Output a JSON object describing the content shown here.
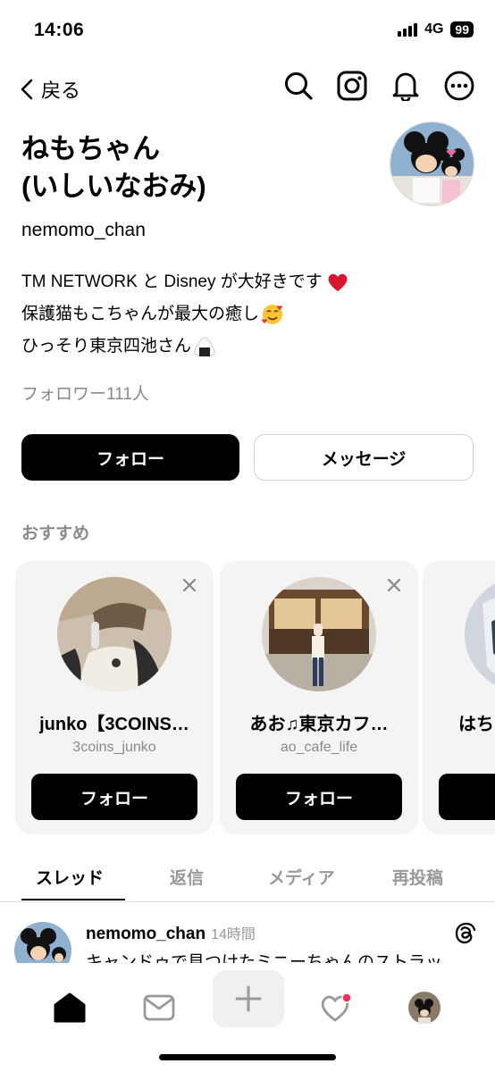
{
  "status_bar": {
    "time": "14:06",
    "network": "4G",
    "battery": "99"
  },
  "nav": {
    "back_label": "戻る",
    "icons": [
      "search-icon",
      "instagram-icon",
      "bell-icon",
      "more-icon"
    ]
  },
  "profile": {
    "name_line1": "ねもちゃん",
    "name_line2": "(いしいなおみ)",
    "username": "nemomo_chan",
    "bio": [
      "TM NETWORK と Disney が大好きです",
      "保護猫もこちゃんが最大の癒し",
      "ひっそり東京四池さん"
    ],
    "bio_emoji": [
      "heart-emoji",
      "smiling-hearts-emoji",
      "onigiri-emoji"
    ],
    "followers": "フォロワー111人"
  },
  "buttons": {
    "follow": "フォロー",
    "message": "メッセージ"
  },
  "suggestions": {
    "title": "おすすめ",
    "cards": [
      {
        "name": "junko【3COINS…",
        "handle": "3coins_junko",
        "button": "フォロー"
      },
      {
        "name": "あお♫東京カフ…",
        "handle": "ao_cafe_life",
        "button": "フォロー"
      },
      {
        "name": "はちみ",
        "handle": "",
        "button": "フ"
      }
    ]
  },
  "tabs": [
    "スレッド",
    "返信",
    "メディア",
    "再投稿"
  ],
  "post": {
    "username": "nemomo_chan",
    "time": "14時間",
    "text": "キャンドゥで見つけたミニーちゃんのストラッ"
  },
  "bottom_nav": [
    "home-icon",
    "inbox-icon",
    "plus-icon",
    "activity-icon",
    "profile-avatar"
  ],
  "colors": {
    "accent": "#000000",
    "muted": "#8a8a8a",
    "notification": "#ff2d55"
  }
}
